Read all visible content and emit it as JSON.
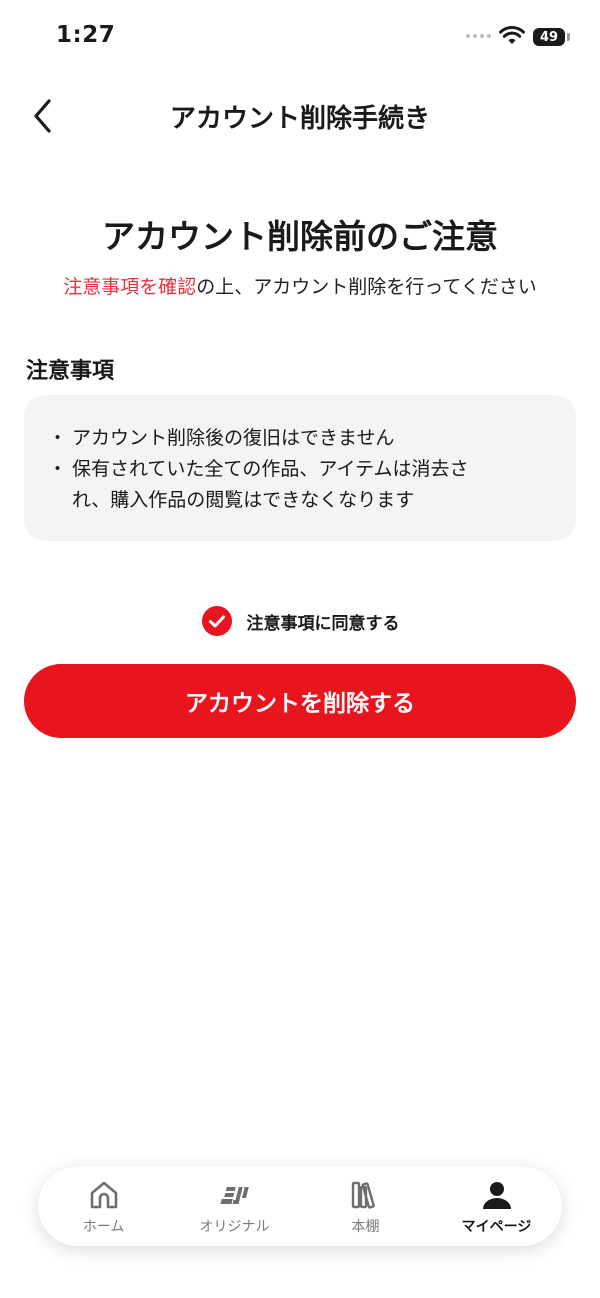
{
  "status_bar": {
    "time": "1:27",
    "battery": "49"
  },
  "header": {
    "title": "アカウント削除手続き"
  },
  "main": {
    "heading": "アカウント削除前のご注意",
    "subline_accent": "注意事項を確認",
    "subline_rest": "の上、アカウント削除を行ってください",
    "section_label": "注意事項",
    "notes": [
      "アカウント削除後の復旧はできません",
      "保有されていた全ての作品、アイテムは消去さ",
      "れ、購入作品の閲覧はできなくなります"
    ],
    "agree_label": "注意事項に同意する",
    "agree_checked": true,
    "delete_button": "アカウントを削除する"
  },
  "tab_bar": {
    "items": [
      {
        "label": "ホーム",
        "icon": "home-icon"
      },
      {
        "label": "オリジナル",
        "icon": "original-logo-icon"
      },
      {
        "label": "本棚",
        "icon": "bookshelf-icon"
      },
      {
        "label": "マイページ",
        "icon": "person-icon"
      }
    ],
    "active": "マイページ"
  },
  "colors": {
    "accent": "#e8141e",
    "text": "#1a1a1a",
    "card": "#f4f4f4"
  }
}
